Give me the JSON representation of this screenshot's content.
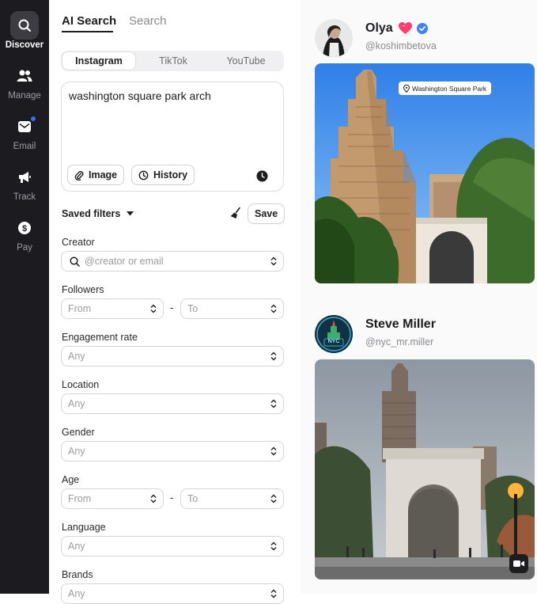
{
  "sidebar": {
    "items": [
      {
        "label": "Discover",
        "icon": "search-icon",
        "active": true
      },
      {
        "label": "Manage",
        "icon": "users-icon"
      },
      {
        "label": "Email",
        "icon": "mail-icon",
        "badge": true
      },
      {
        "label": "Track",
        "icon": "megaphone-icon"
      },
      {
        "label": "Pay",
        "icon": "dollar-icon"
      }
    ]
  },
  "tabs": {
    "ai_search": "AI Search",
    "search": "Search"
  },
  "platforms": [
    "Instagram",
    "TikTok",
    "YouTube"
  ],
  "query": {
    "text": "washington square park arch",
    "image_label": "Image",
    "history_label": "History"
  },
  "saved_filters": {
    "label": "Saved filters",
    "save_label": "Save"
  },
  "filters": {
    "creator": {
      "label": "Creator",
      "placeholder": "@creator or email"
    },
    "followers": {
      "label": "Followers",
      "from": "From",
      "to": "To"
    },
    "engagement": {
      "label": "Engagement rate",
      "value": "Any"
    },
    "location": {
      "label": "Location",
      "value": "Any"
    },
    "gender": {
      "label": "Gender",
      "value": "Any"
    },
    "age": {
      "label": "Age",
      "from": "From",
      "to": "To"
    },
    "language": {
      "label": "Language",
      "value": "Any"
    },
    "brands": {
      "label": "Brands",
      "value": "Any"
    }
  },
  "results": [
    {
      "name": "Olya",
      "handle": "@koshimbetova",
      "location_tag": "Washington Square Park"
    },
    {
      "name": "Steve Miller",
      "handle": "@nyc_mr.miller",
      "avatar_text": "NYC"
    }
  ],
  "colors": {
    "sidebar": "#1c1c20",
    "accent": "#3b6cf6",
    "verified": "#3b82f6"
  }
}
